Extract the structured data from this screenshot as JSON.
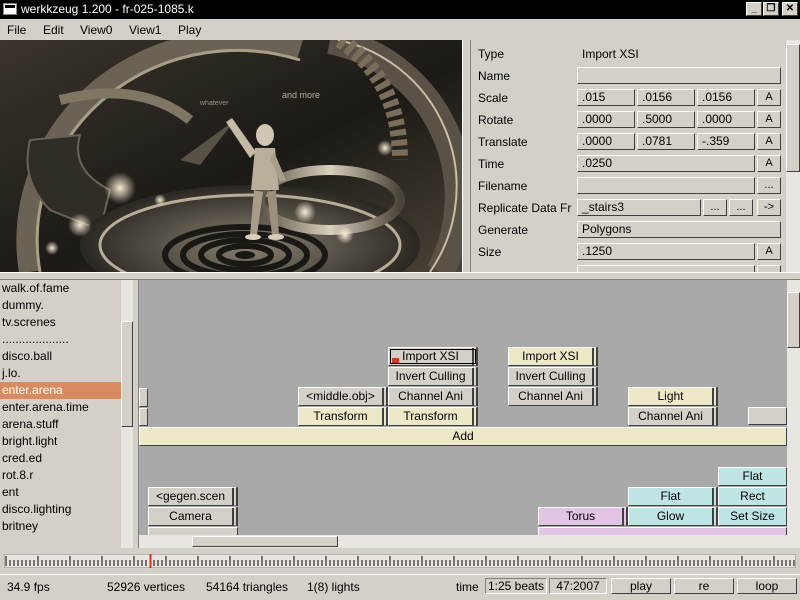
{
  "window": {
    "title": "werkkzeug 1.200 - fr-025-1085.k",
    "minimize_glyph": "_",
    "maximize_glyph": "❐",
    "close_glyph": "✕"
  },
  "menu": [
    "File",
    "Edit",
    "View0",
    "View1",
    "Play"
  ],
  "properties": {
    "type_label": "Type",
    "type_value": "Import XSI",
    "name_label": "Name",
    "name_value": "",
    "scale_label": "Scale",
    "scale_values": [
      ".015",
      ".0156",
      ".0156"
    ],
    "rotate_label": "Rotate",
    "rotate_values": [
      ".0000",
      ".5000",
      ".0000"
    ],
    "translate_label": "Translate",
    "translate_values": [
      ".0000",
      ".0781",
      "-.359"
    ],
    "time_label": "Time",
    "time_value": ".0250",
    "filename_label": "Filename",
    "filename_value": "",
    "replicate_label": "Replicate Data Fr",
    "replicate_value": "_stairs3",
    "generate_label": "Generate",
    "generate_value": "Polygons",
    "size_label": "Size",
    "size_value": ".1250",
    "anim_button": "A",
    "browse_button": "...",
    "goto_button": "->"
  },
  "pages": [
    "walk.of.fame",
    "dummy.",
    "tv.screnes",
    "....................",
    "disco.ball",
    "j.lo.",
    "enter.arena",
    "enter.arena.time",
    "arena.stuff",
    "bright.light",
    "cred.ed",
    "rot.8.r",
    "ent",
    "disco.lighting",
    "britney"
  ],
  "selected_page": "enter.arena",
  "operators": {
    "import_xsi_1": "Import XSI",
    "invert_culling_1": "Invert Culling",
    "channel_ani_1": "Channel Ani",
    "transform_2": "Transform",
    "middle_obj": "<middle.obj>",
    "transform_1": "Transform",
    "import_xsi_2": "Import XSI",
    "invert_culling_2": "Invert Culling",
    "channel_ani_2": "Channel Ani",
    "light": "Light",
    "channel_ani_3": "Channel Ani",
    "add": "Add",
    "gegen_scen": "<gegen.scen",
    "camera": "Camera",
    "flat_1": "Flat",
    "flat_2": "Flat",
    "rect": "Rect",
    "torus": "Torus",
    "glow": "Glow",
    "set_size": "Set Size"
  },
  "colors": {
    "selected_page": "#d88a60",
    "graph_background": "#a9a9a9",
    "op_grey": "#d4d0c8",
    "op_cream": "#ece8c8",
    "op_cyan": "#bfe4e4",
    "op_pink": "#e2c4e4",
    "marker_red": "#d8322a"
  },
  "viewport": {
    "overlay_text": [
      "and more",
      "whatever"
    ]
  },
  "timeline": {
    "playhead_fraction": 0.185
  },
  "status": {
    "fps": "34.9 fps",
    "vertices": "52926 vertices",
    "triangles": "54164 triangles",
    "lights": "1(8) lights",
    "time_label": "time",
    "time_field_1": "1:25 beats",
    "time_field_2": "47:2007",
    "play_button": "play",
    "re_button": "re",
    "loop_button": "loop"
  }
}
